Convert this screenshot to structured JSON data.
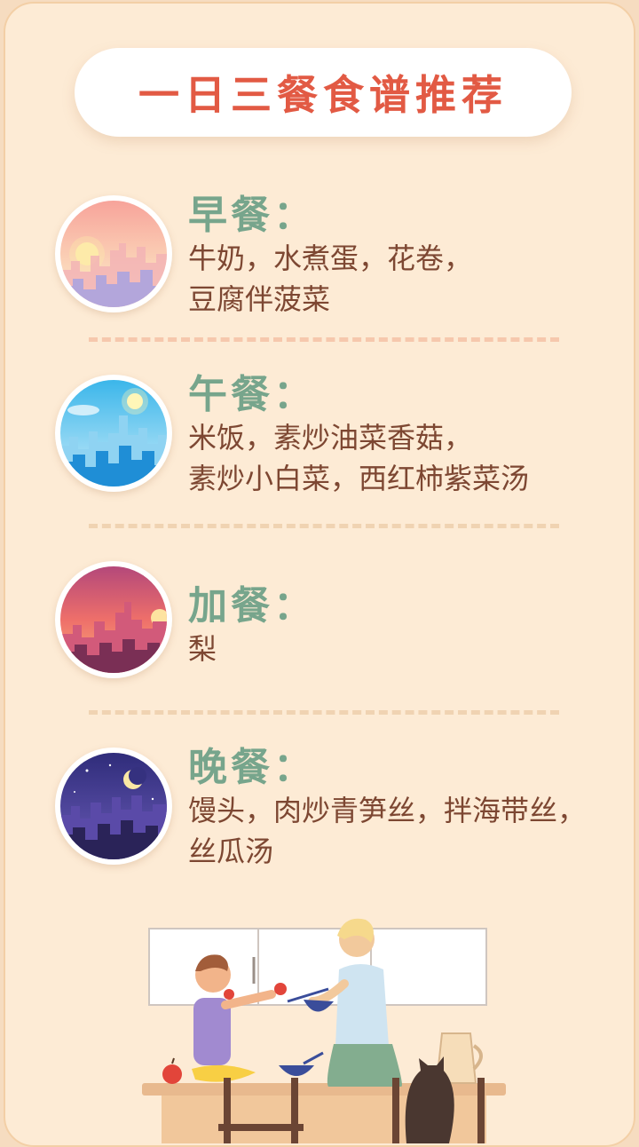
{
  "title": "一日三餐食谱推荐",
  "meals": [
    {
      "label": "早餐：",
      "items": [
        "牛奶，水煮蛋，花卷，",
        "豆腐伴菠菜"
      ],
      "icon": "sunrise-city-icon"
    },
    {
      "label": "午餐：",
      "items": [
        "米饭，素炒油菜香菇，",
        "素炒小白菜，西红柿紫菜汤"
      ],
      "icon": "noon-city-icon"
    },
    {
      "label": "加餐：",
      "items": [
        "梨"
      ],
      "icon": "sunset-city-icon"
    },
    {
      "label": "晚餐：",
      "items": [
        "馒头，肉炒青笋丝，拌海带丝，",
        "丝瓜汤"
      ],
      "icon": "night-city-icon"
    }
  ],
  "colors": {
    "background": "#fdebd5",
    "title": "#e25a44",
    "label": "#77a58c",
    "text": "#7d4732"
  }
}
